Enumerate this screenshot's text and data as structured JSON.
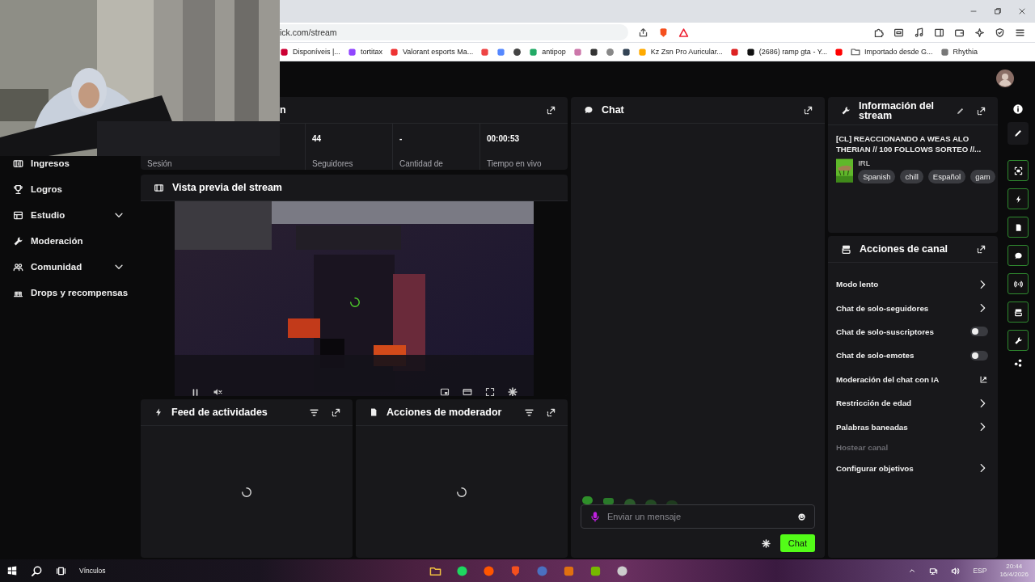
{
  "browser": {
    "address": "ick.com/stream",
    "bookmarks": [
      {
        "kind": "link",
        "label": "Disponíveis |..."
      },
      {
        "kind": "link",
        "label": "tortitax"
      },
      {
        "kind": "link",
        "label": "Valorant esports Ma..."
      },
      {
        "kind": "icon"
      },
      {
        "kind": "icon"
      },
      {
        "kind": "icon"
      },
      {
        "kind": "link",
        "label": "antipop"
      },
      {
        "kind": "icon"
      },
      {
        "kind": "icon"
      },
      {
        "kind": "icon"
      },
      {
        "kind": "icon"
      },
      {
        "kind": "link",
        "label": "Kz Zsn Pro Auricular..."
      },
      {
        "kind": "icon"
      },
      {
        "kind": "link",
        "label": "(2686) ramp gta - Y..."
      },
      {
        "kind": "icon"
      },
      {
        "kind": "folder",
        "label": "Importado desde G..."
      },
      {
        "kind": "link",
        "label": "Rhythia"
      }
    ]
  },
  "sidebar": {
    "items": [
      {
        "label": "Ingresos",
        "expandable": false
      },
      {
        "label": "Logros",
        "expandable": false
      },
      {
        "label": "Estudio",
        "expandable": true
      },
      {
        "label": "Moderación",
        "expandable": false
      },
      {
        "label": "Comunidad",
        "expandable": true
      },
      {
        "label": "Drops y recompensas",
        "expandable": false
      }
    ]
  },
  "stats": {
    "title": "n",
    "cells": [
      {
        "label": "Sesión"
      },
      {
        "value": "44",
        "label": "Seguidores"
      },
      {
        "value": "-",
        "label": "Cantidad de"
      },
      {
        "value": "00:00:53",
        "label": "Tiempo en vivo"
      }
    ]
  },
  "preview": {
    "title": "Vista previa del stream"
  },
  "activity_feed": {
    "title": "Feed de actividades"
  },
  "mod_actions": {
    "title": "Acciones de moderador"
  },
  "chat": {
    "title": "Chat",
    "placeholder": "Enviar un mensaje",
    "send_button": "Chat"
  },
  "stream_info": {
    "title": "Información del stream",
    "stream_title": "[CL] REACCIONANDO A WEAS ALO THERIAN // 100 FOLLOWS SORTEO //...",
    "category": "IRL",
    "tags": [
      "Spanish",
      "chill",
      "Español",
      "gam"
    ]
  },
  "channel_actions": {
    "title": "Acciones de canal",
    "rows": [
      {
        "label": "Modo lento",
        "kind": "chevron",
        "disabled": false
      },
      {
        "label": "Chat de solo-seguidores",
        "kind": "chevron",
        "disabled": false
      },
      {
        "label": "Chat de solo-suscriptores",
        "kind": "toggle",
        "checked": false,
        "disabled": false
      },
      {
        "label": "Chat de solo-emotes",
        "kind": "toggle",
        "checked": false,
        "disabled": false
      },
      {
        "label": "Moderación del chat con IA",
        "kind": "external",
        "disabled": false
      },
      {
        "label": "Restricción de edad",
        "kind": "chevron",
        "disabled": false
      },
      {
        "label": "Palabras baneadas",
        "kind": "chevron",
        "disabled": false
      },
      {
        "label": "Hostear canal",
        "kind": "plain",
        "disabled": true
      },
      {
        "label": "Configurar objetivos",
        "kind": "chevron",
        "disabled": false
      }
    ]
  },
  "taskbar": {
    "links_label": "Vínculos",
    "language": "ESP",
    "time": "20:44",
    "date": "16/4/2026"
  }
}
